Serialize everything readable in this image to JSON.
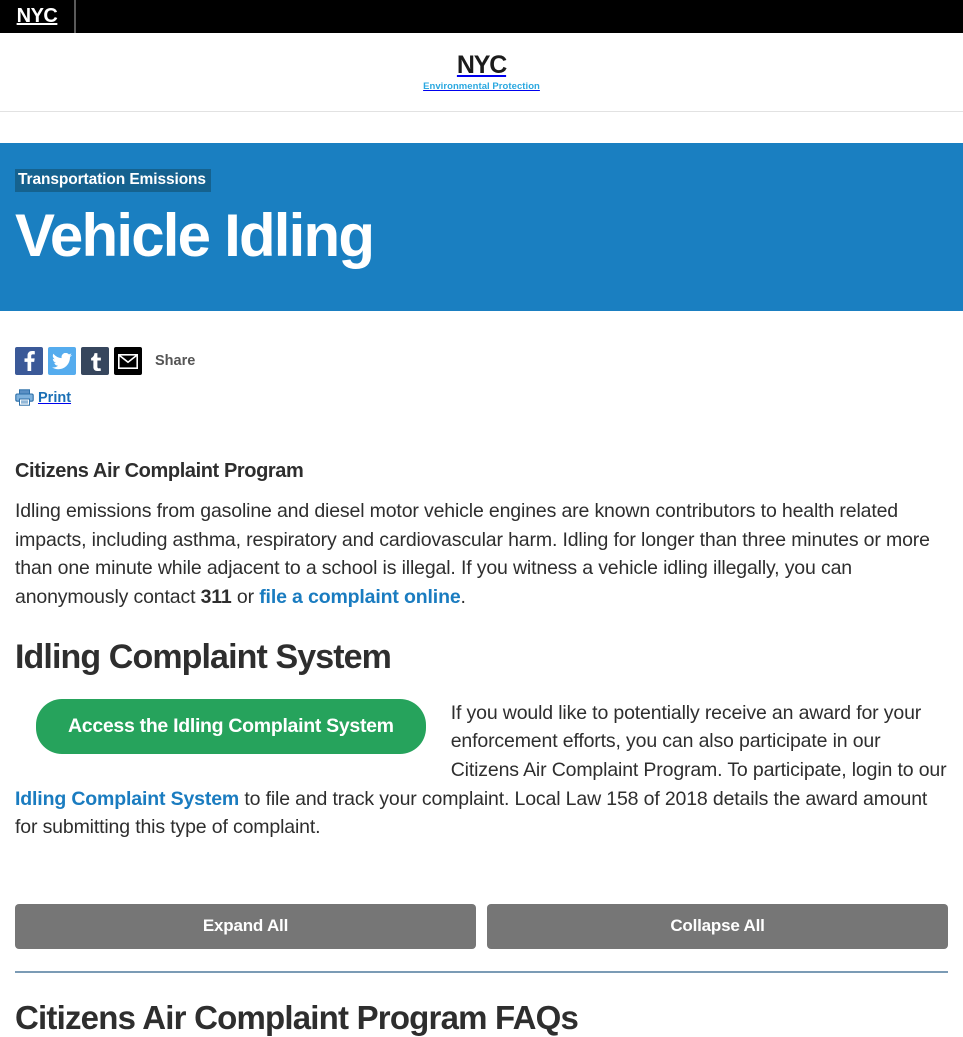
{
  "topbar": {
    "logo_text": "NYC"
  },
  "header": {
    "logo_nyc": "NYC",
    "agency_name": "Environmental Protection"
  },
  "banner": {
    "eyebrow": "Transportation Emissions",
    "title": "Vehicle Idling",
    "background_color": "#1a7fc1",
    "eyebrow_background_color": "#15628f"
  },
  "share": {
    "facebook_label": "f",
    "twitter_label": "t",
    "tumblr_label": "t",
    "email_label": "email-icon",
    "share_label": "Share",
    "print_label": "Print",
    "print_color": "#1a6fb5"
  },
  "main": {
    "sub_heading": "Citizens Air Complaint Program",
    "intro_part1": "Idling emissions from gasoline and diesel motor vehicle engines are known contributors to health related impacts, including asthma, respiratory and cardiovascular harm. Idling for longer than three minutes or more than one minute while adjacent to a school is illegal. If you witness a vehicle idling illegally, you can anonymously contact ",
    "intro_311": "311",
    "intro_part2": " or ",
    "intro_link": "file a complaint online",
    "intro_part3": ".",
    "section_heading": "Idling Complaint System",
    "cta_button": "Access the Idling Complaint System",
    "cta_color": "#26a35c",
    "cta_para_part1": "If you would like to potentially receive an award for your enforcement efforts, you can also participate in our Citizens Air Complaint Program. To participate, login to our ",
    "cta_para_link": "Idling Complaint System",
    "cta_para_part2": " to file and track your complaint. Local Law 158 of 2018 details the award amount for submitting this type of complaint.",
    "link_color": "#1a7cc0"
  },
  "toggles": {
    "expand_all": "Expand All",
    "collapse_all": "Collapse All",
    "button_color": "#767676"
  },
  "faq": {
    "heading": "Citizens Air Complaint Program FAQs",
    "divider_color": "#7b9bb5"
  }
}
